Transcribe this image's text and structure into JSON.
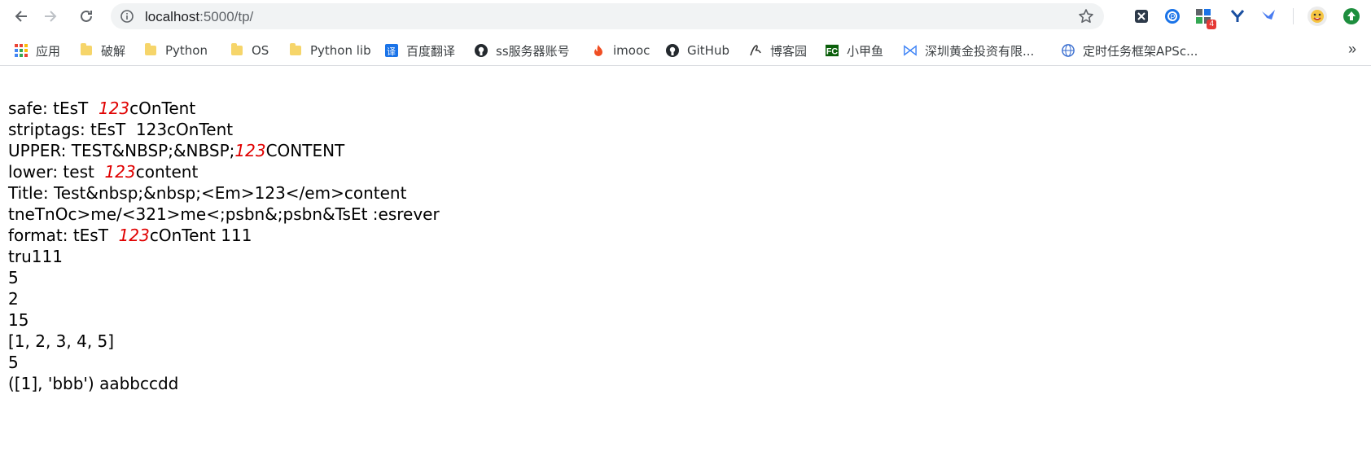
{
  "browser": {
    "url_host": "localhost",
    "url_path": ":5000/tp/",
    "extensions": [
      {
        "name": "x-extension-icon"
      },
      {
        "name": "p-extension-icon"
      },
      {
        "name": "grid-extension-icon",
        "badge": "4"
      },
      {
        "name": "y-extension-icon"
      },
      {
        "name": "bird-extension-icon"
      },
      {
        "name": "emoji-profile-icon"
      },
      {
        "name": "green-update-icon"
      }
    ]
  },
  "bookmarks": [
    {
      "label": "应用",
      "icon": "apps-grid-icon"
    },
    {
      "label": "破解",
      "icon": "folder-icon"
    },
    {
      "label": "Python",
      "icon": "folder-icon"
    },
    {
      "label": "OS",
      "icon": "folder-icon"
    },
    {
      "label": "Python lib",
      "icon": "folder-icon"
    },
    {
      "label": "百度翻译",
      "icon": "translate-icon"
    },
    {
      "label": "ss服务器账号",
      "icon": "github-icon"
    },
    {
      "label": "imooc",
      "icon": "flame-icon"
    },
    {
      "label": "GitHub",
      "icon": "github-icon"
    },
    {
      "label": "博客园",
      "icon": "cnblogs-icon"
    },
    {
      "label": "小甲鱼",
      "icon": "fc-icon"
    },
    {
      "label": "深圳黄金投资有限...",
      "icon": "bowtie-icon"
    },
    {
      "label": "定时任务框架APSc...",
      "icon": "globe-icon"
    }
  ],
  "bookmarks_more": "»",
  "output": {
    "safe_prefix": "safe: tEsT  ",
    "safe_em": "123",
    "safe_suffix": "cOnTent",
    "striptags": "striptags: tEsT  123cOnTent",
    "upper_prefix": "UPPER: TEST&NBSP;&NBSP;",
    "upper_em": "123",
    "upper_suffix": "CONTENT",
    "lower_prefix": "lower: test  ",
    "lower_em": "123",
    "lower_suffix": "content",
    "title": "Title: Test&nbsp;&nbsp;<Em>123</em>content",
    "reverse": "tneTnOc>me/<321>me<;psbn&;psbn&TsEt :esrever",
    "format_prefix": "format: tEsT  ",
    "format_em": "123",
    "format_suffix": "cOnTent 111",
    "tru": "tru111",
    "val1": "5",
    "val2": "2",
    "val3": "15",
    "list": "[1, 2, 3, 4, 5]",
    "val4": "5",
    "tuple": "([1], 'bbb') aabbccdd"
  }
}
